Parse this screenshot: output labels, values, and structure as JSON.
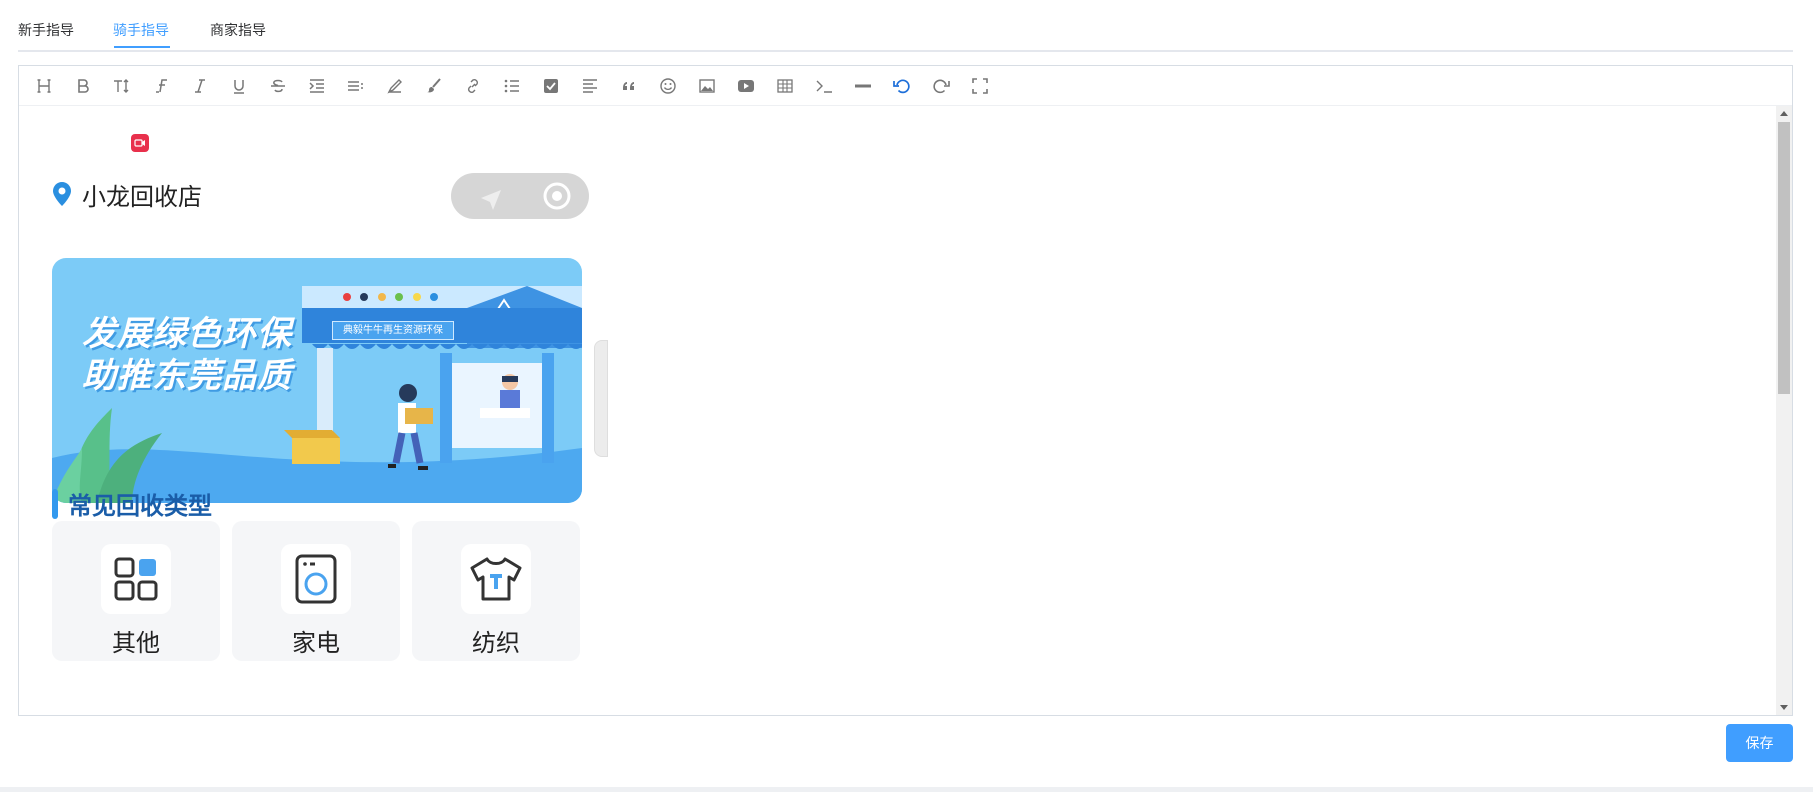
{
  "tabs": [
    {
      "label": "新手指导",
      "active": false
    },
    {
      "label": "骑手指导",
      "active": true
    },
    {
      "label": "商家指导",
      "active": false
    }
  ],
  "toolbar_icons": [
    "heading-icon",
    "bold-icon",
    "font-size-icon",
    "font-family-icon",
    "italic-icon",
    "underline-icon",
    "strikethrough-icon",
    "indent-icon",
    "line-height-icon",
    "highlight-icon",
    "paint-brush-icon",
    "link-icon",
    "bullet-list-icon",
    "checkbox-icon",
    "align-left-icon",
    "quote-icon",
    "emoji-icon",
    "image-icon",
    "video-icon",
    "table-icon",
    "code-icon",
    "horizontal-rule-icon",
    "undo-icon",
    "redo-icon",
    "fullscreen-icon"
  ],
  "content": {
    "store_name": "小龙回收店",
    "banner": {
      "line1": "发展绿色环保",
      "line2": "助推东莞品质",
      "shop_sign": "典毅牛牛再生资源环保"
    },
    "section_title": "常见回收类型",
    "categories": [
      {
        "label": "其他",
        "icon": "grid-apps-icon"
      },
      {
        "label": "家电",
        "icon": "washing-machine-icon"
      },
      {
        "label": "纺织",
        "icon": "t-shirt-icon"
      }
    ]
  },
  "actions": {
    "save_label": "保存"
  },
  "colors": {
    "accent": "#409eff",
    "section_title": "#1a5da8",
    "record_badge": "#e8304c"
  }
}
